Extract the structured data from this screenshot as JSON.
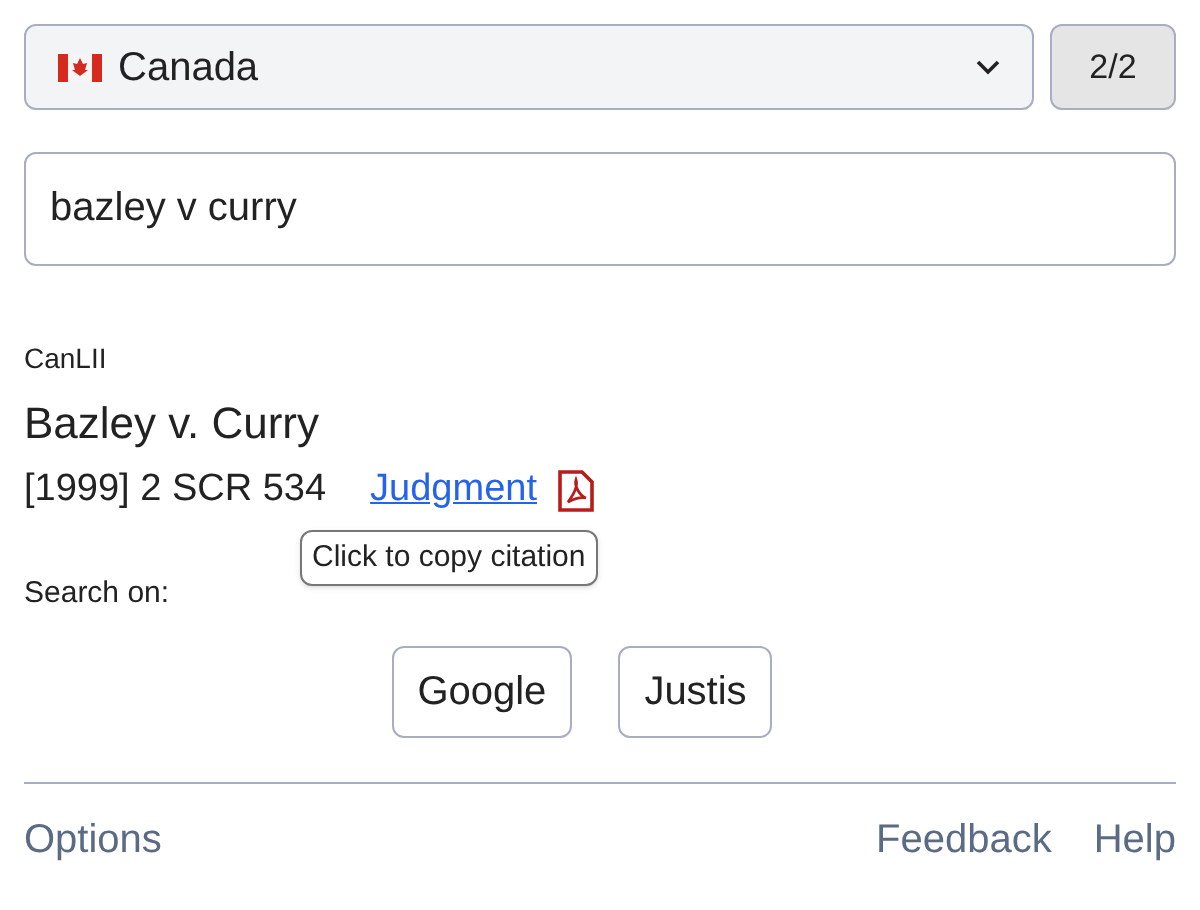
{
  "jurisdiction_select": {
    "value": "Canada"
  },
  "page_counter": "2/2",
  "search_field": {
    "value": "bazley v curry"
  },
  "result": {
    "source": "CanLII",
    "title": "Bazley v. Curry",
    "citation": "[1999] 2 SCR 534",
    "link": "Judgment",
    "tooltip": "Click to copy citation"
  },
  "search_on": {
    "label": "Search on:",
    "buttons": [
      "Google",
      "Justis"
    ]
  },
  "footer": {
    "left": [
      "Options"
    ],
    "right": [
      "Feedback",
      "Help"
    ]
  }
}
